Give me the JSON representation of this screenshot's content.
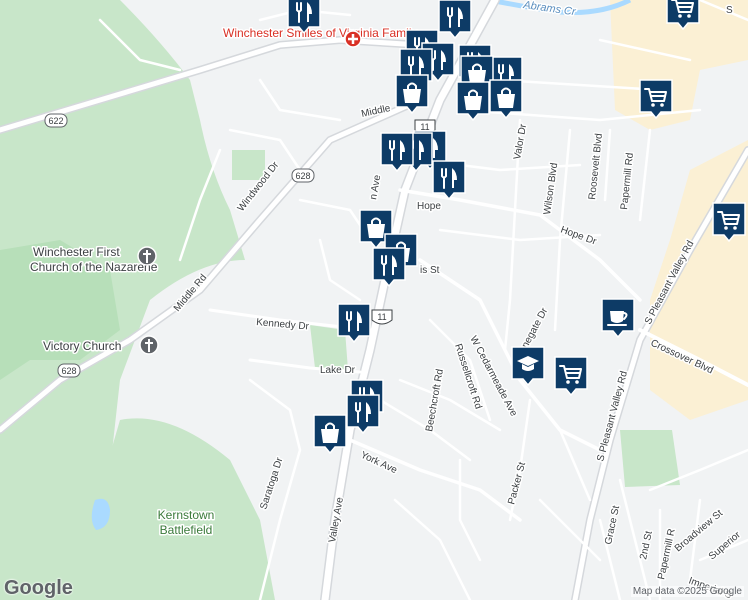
{
  "map": {
    "attribution": "Map data ©2025 Google",
    "logo_text": "Google",
    "colors": {
      "background": "#f1f3f4",
      "park": "#c8e6c9",
      "park_dark": "#b7dfb9",
      "commercial": "#fbf0d4",
      "water": "#aadaff",
      "road": "#ffffff",
      "pin": "#0d3b66",
      "hospital": "#d93025"
    }
  },
  "places": {
    "hospital": "Winchester Smiles of Virginia Family...",
    "church1_line1": "Winchester First",
    "church1_line2": "Church of the Nazarene",
    "church2": "Victory Church",
    "battlefield_line1": "Kernstown",
    "battlefield_line2": "Battlefield",
    "water": "Abrams Cr"
  },
  "streets": {
    "middle_rd_upper": "Middle",
    "middle_rd": "Middle Rd",
    "windwood": "Windwood Dr",
    "kennedy": "Kennedy Dr",
    "lake": "Lake Dr",
    "valley_ave": "Valley Ave",
    "york": "York Ave",
    "saratoga": "Saratoga Dr",
    "hope_left": "Hope",
    "hope_right": "Hope Dr",
    "valor": "Valor Dr",
    "wilson": "Wilson Blvd",
    "roosevelt": "Roosevelt Blvd",
    "papermill_upper": "Papermill Rd",
    "papermill_lower": "Papermill R",
    "s_pleasant_upper": "S Pleasant Valley Rd",
    "s_pleasant_lower": "S Pleasant Valley Rd",
    "crossover": "Crossover Blvd",
    "w_cedarmeade": "W Cedarmeade Ave",
    "russellcroft": "Russellcroft Rd",
    "beechcroft": "Beechcroft Rd",
    "stonegate": "Stonegate Dr",
    "packer": "Packer St",
    "grace": "Grace St",
    "second": "2nd St",
    "broadview": "Broadview St",
    "superior": "Superior",
    "imperial": "Imperial S",
    "ave_partial": "n Ave",
    "st_partial": "is St",
    "s_partial": "S"
  },
  "shields": {
    "r622": "622",
    "r628a": "628",
    "r628b": "628",
    "us11a": "11",
    "us11b": "11"
  },
  "pins": {
    "restaurant": "restaurant-icon",
    "shopping": "shopping-bag-icon",
    "grocery": "grocery-cart-icon",
    "cafe": "cafe-icon",
    "school": "school-icon"
  }
}
